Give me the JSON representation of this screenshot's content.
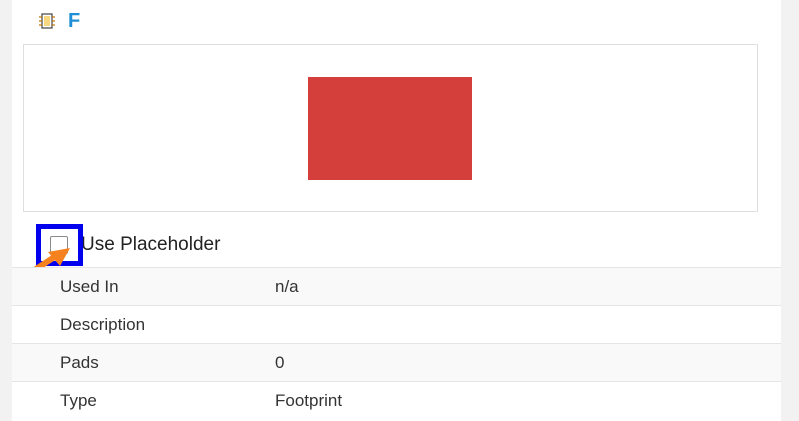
{
  "component": {
    "icon": "footprint-chip-icon",
    "name": "F"
  },
  "preview": {
    "shape_color": "#d43f3c"
  },
  "placeholder": {
    "label": "Use Placeholder",
    "checked": false,
    "highlight_color": "#0000ee",
    "arrow_color": "#f5821f"
  },
  "properties": [
    {
      "key": "Used In",
      "value": "n/a"
    },
    {
      "key": "Description",
      "value": ""
    },
    {
      "key": "Pads",
      "value": "0"
    },
    {
      "key": "Type",
      "value": "Footprint"
    }
  ]
}
